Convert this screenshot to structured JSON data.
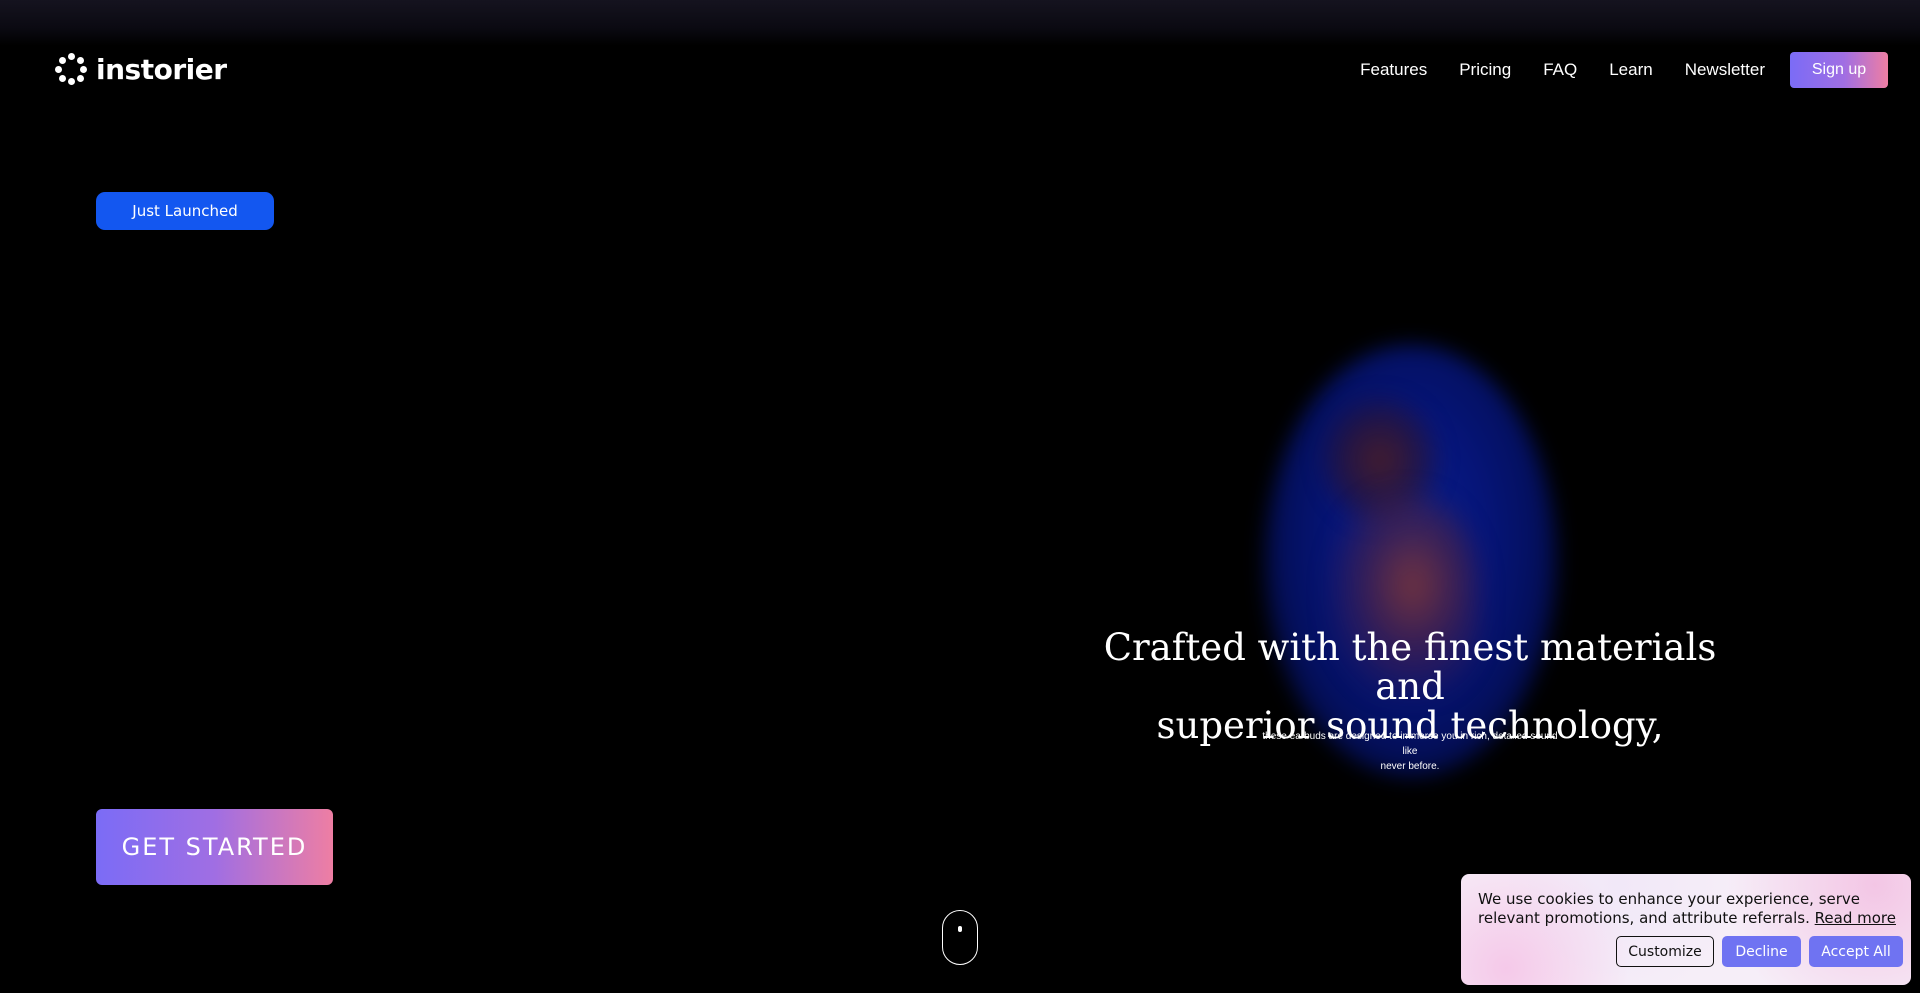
{
  "header": {
    "brand": "instorier",
    "nav": [
      {
        "label": "Features"
      },
      {
        "label": "Pricing"
      },
      {
        "label": "FAQ"
      },
      {
        "label": "Learn"
      },
      {
        "label": "Newsletter"
      }
    ],
    "signup_label": "Sign up"
  },
  "hero": {
    "badge": "Just Launched",
    "title_line1": "Crafted with the finest materials and",
    "title_line2": "superior sound technology,",
    "subtitle_line1": "these earbuds are designed to immerse you in rich, detailed sound like",
    "subtitle_line2": "never before.",
    "cta_label": "GET STARTED"
  },
  "cookie": {
    "text": "We use cookies to enhance your experience, serve relevant promotions, and attribute referrals.",
    "read_more": "Read more",
    "customize": "Customize",
    "decline": "Decline",
    "accept": "Accept All"
  },
  "icons": {
    "logo": "instorier-logo-icon",
    "scroll": "scroll-mouse-icon"
  },
  "colors": {
    "background": "#000000",
    "badge": "#1357f0",
    "accent_gradient_start": "#7b6cf6",
    "accent_gradient_end": "#ee7ea3",
    "cookie_button": "#6f73f2"
  }
}
